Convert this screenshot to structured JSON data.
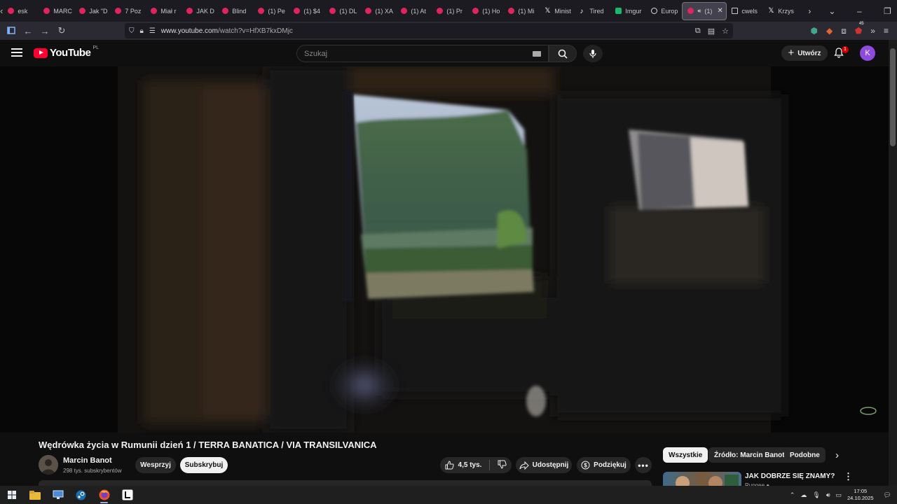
{
  "browser": {
    "tabs": [
      {
        "title": "esk",
        "icon": "red-dot"
      },
      {
        "title": "MARC",
        "icon": "youtube"
      },
      {
        "title": "Jak \"D",
        "icon": "youtube"
      },
      {
        "title": "7 Poz",
        "icon": "youtube"
      },
      {
        "title": "Miał r",
        "icon": "youtube"
      },
      {
        "title": "JAK D",
        "icon": "youtube"
      },
      {
        "title": "Blind",
        "icon": "youtube"
      },
      {
        "title": "(1) Pe",
        "icon": "youtube"
      },
      {
        "title": "(1) $4",
        "icon": "youtube"
      },
      {
        "title": "(1) DL",
        "icon": "youtube"
      },
      {
        "title": "(1) XA",
        "icon": "youtube"
      },
      {
        "title": "(1) At",
        "icon": "youtube"
      },
      {
        "title": "(1) Pr",
        "icon": "youtube"
      },
      {
        "title": "(1) Ho",
        "icon": "youtube"
      },
      {
        "title": "(1) Mi",
        "icon": "youtube"
      },
      {
        "title": "Minist",
        "icon": "x"
      },
      {
        "title": "Tired",
        "icon": "tiktok"
      },
      {
        "title": "Imgur",
        "icon": "imgur"
      },
      {
        "title": "Europ",
        "icon": "globe"
      },
      {
        "title": "(1)",
        "icon": "youtube",
        "active": true
      },
      {
        "title": "cwels",
        "icon": "doc"
      },
      {
        "title": "Krzys",
        "icon": "x"
      }
    ],
    "url_host": "www.youtube.com",
    "url_path": "/watch?v=HfXB7kxDMjc",
    "ext_badge": "45"
  },
  "youtube": {
    "logo_text": "YouTube",
    "country_code": "PL",
    "search_placeholder": "Szukaj",
    "create_label": "Utwórz",
    "notifications_count": "1",
    "avatar_letter": "K"
  },
  "video": {
    "title": "Wędrówka życia w Rumunii dzień 1 / TERRA BANATICA / VIA TRANSILVANICA",
    "channel_name": "Marcin Banot",
    "subscribers": "298 tys. subskrybentów",
    "support_label": "Wesprzyj",
    "subscribe_label": "Subskrybuj",
    "likes": "4,5 tys.",
    "share_label": "Udostępnij",
    "thanks_label": "Podziękuj"
  },
  "chips": [
    "Wszystkie",
    "Źródło: Marcin Banot",
    "Podobne"
  ],
  "recommendation": {
    "title": "JAK DOBRZE SIĘ ZNAMY?",
    "channel": "Rupgee"
  },
  "taskbar": {
    "time": "17:05",
    "date": "24.10.2025"
  }
}
